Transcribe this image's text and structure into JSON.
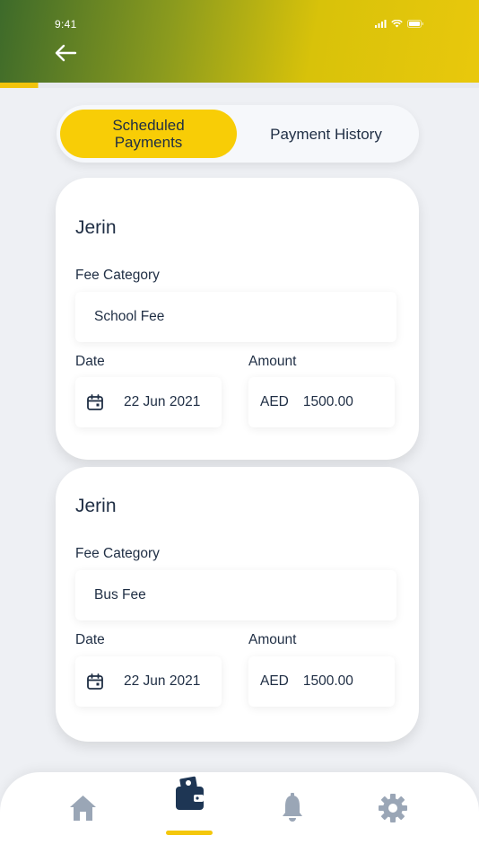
{
  "status_bar": {
    "time": "9:41"
  },
  "tabs": {
    "scheduled": "Scheduled Payments",
    "history": "Payment History"
  },
  "labels": {
    "fee_category": "Fee Category",
    "date": "Date",
    "amount": "Amount"
  },
  "payments": [
    {
      "name": "Jerin",
      "fee_category": "School Fee",
      "date": "22 Jun 2021",
      "currency": "AED",
      "amount": "1500.00"
    },
    {
      "name": "Jerin",
      "fee_category": "Bus Fee",
      "date": "22 Jun 2021",
      "currency": "AED",
      "amount": "1500.00"
    }
  ],
  "bottom_nav": {
    "items": [
      {
        "icon": "home-icon",
        "active": false
      },
      {
        "icon": "wallet-icon",
        "active": true
      },
      {
        "icon": "bell-icon",
        "active": false
      },
      {
        "icon": "gear-icon",
        "active": false
      }
    ]
  },
  "colors": {
    "accent_yellow": "#f8cd06",
    "header_green": "#3d6a2a",
    "text_dark": "#1f2e44",
    "nav_icon_inactive": "#9aa6b6",
    "nav_icon_active": "#1e3654"
  }
}
